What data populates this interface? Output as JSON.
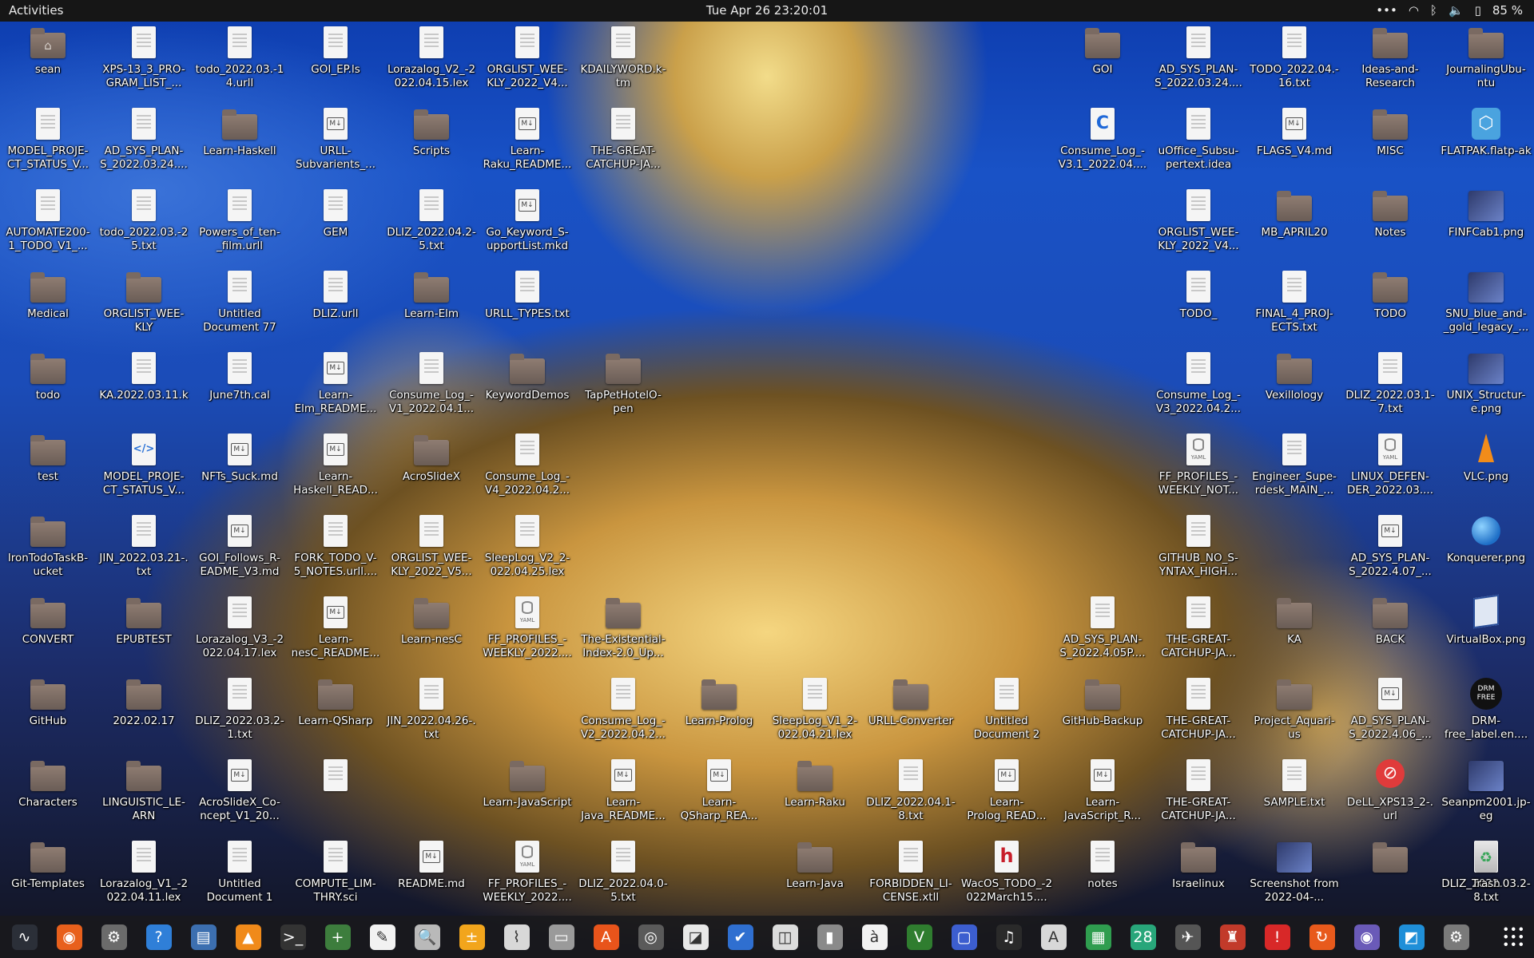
{
  "topbar": {
    "activities": "Activities",
    "clock": "Tue Apr 26  23:20:01",
    "battery": "85 %",
    "tray_icons": [
      "more-dots-icon",
      "wifi-icon",
      "bluetooth-icon",
      "volume-icon",
      "battery-icon"
    ]
  },
  "desktop_icons": [
    {
      "label": "sean",
      "type": "home"
    },
    {
      "label": "XPS-13_3_PRO-GRAM_LIST_...",
      "type": "doc"
    },
    {
      "label": "todo_2022.03.-14.urll",
      "type": "doc"
    },
    {
      "label": "GOI_EP.ls",
      "type": "doc"
    },
    {
      "label": "Lorazalog_V2_-2022.04.15.lex",
      "type": "doc"
    },
    {
      "label": "ORGLIST_WEE-KLY_2022_V4...",
      "type": "doc"
    },
    {
      "label": "KDAILYWORD.k-tm",
      "type": "doc"
    },
    {
      "label": "GOI",
      "type": "folder"
    },
    {
      "label": "AD_SYS_PLAN-S_2022.03.24....",
      "type": "doc"
    },
    {
      "label": "TODO_2022.04.-16.txt",
      "type": "doc"
    },
    {
      "label": "Ideas-and-Research",
      "type": "folder"
    },
    {
      "label": "JournalingUbu-ntu",
      "type": "folder"
    },
    {
      "label": "MODEL_PROJE-CT_STATUS_V...",
      "type": "doc"
    },
    {
      "label": "AD_SYS_PLAN-S_2022.03.24....",
      "type": "doc"
    },
    {
      "label": "Learn-Haskell",
      "type": "folder"
    },
    {
      "label": "URLL-Subvarients_...",
      "type": "md"
    },
    {
      "label": "Scripts",
      "type": "folder"
    },
    {
      "label": "Learn-Raku_README...",
      "type": "md"
    },
    {
      "label": "THE-GREAT-CATCHUP-JA...",
      "type": "doc"
    },
    {
      "label": "Consume_Log_-V3.1_2022.04....",
      "type": "cdoc"
    },
    {
      "label": "uOffice_Subsu-pertext.idea",
      "type": "doc"
    },
    {
      "label": "FLAGS_V4.md",
      "type": "md"
    },
    {
      "label": "MISC",
      "type": "folder"
    },
    {
      "label": "FLATPAK.flatp-ak",
      "type": "flatpak"
    },
    {
      "label": "AUTOMATE200-1_TODO_V1_...",
      "type": "doc"
    },
    {
      "label": "todo_2022.03.-25.txt",
      "type": "doc"
    },
    {
      "label": "Powers_of_ten-_film.urll",
      "type": "doc"
    },
    {
      "label": "GEM",
      "type": "doc"
    },
    {
      "label": "DLIZ_2022.04.2-5.txt",
      "type": "doc"
    },
    {
      "label": "Go_Keyword_S-upportList.mkd",
      "type": "md"
    },
    {
      "label": "ORGLIST_WEE-KLY_2022_V4...",
      "type": "doc"
    },
    {
      "label": "MB_APRIL20",
      "type": "folder"
    },
    {
      "label": "Notes",
      "type": "folder"
    },
    {
      "label": "FINFCab1.png",
      "type": "img"
    },
    {
      "label": "Medical",
      "type": "folder"
    },
    {
      "label": "ORGLIST_WEE-KLY",
      "type": "folder"
    },
    {
      "label": "Untitled Document 77",
      "type": "doc"
    },
    {
      "label": "DLIZ.urll",
      "type": "doc"
    },
    {
      "label": "Learn-Elm",
      "type": "folder"
    },
    {
      "label": "URLL_TYPES.txt",
      "type": "doc"
    },
    {
      "label": "TODO_",
      "type": "doc"
    },
    {
      "label": "FINAL_4_PROJ-ECTS.txt",
      "type": "doc"
    },
    {
      "label": "TODO",
      "type": "folder"
    },
    {
      "label": "SNU_blue_and-_gold_legacy_...",
      "type": "img"
    },
    {
      "label": "todo",
      "type": "folder"
    },
    {
      "label": "KA.2022.03.11.k",
      "type": "doc"
    },
    {
      "label": "June7th.cal",
      "type": "doc"
    },
    {
      "label": "Learn-Elm_README...",
      "type": "md"
    },
    {
      "label": "Consume_Log_-V1_2022.04.1...",
      "type": "doc"
    },
    {
      "label": "KeywordDemos",
      "type": "folder"
    },
    {
      "label": "TapPetHotelO-pen",
      "type": "folder"
    },
    {
      "label": "Consume_Log_-V3_2022.04.2...",
      "type": "doc"
    },
    {
      "label": "Vexillology",
      "type": "folder"
    },
    {
      "label": "DLIZ_2022.03.1-7.txt",
      "type": "doc"
    },
    {
      "label": "UNIX_Structur-e.png",
      "type": "img"
    },
    {
      "label": "test",
      "type": "folder"
    },
    {
      "label": "MODEL_PROJE-CT_STATUS_V...",
      "type": "code"
    },
    {
      "label": "NFTs_Suck.md",
      "type": "md"
    },
    {
      "label": "Learn-Haskell_READ...",
      "type": "md"
    },
    {
      "label": "AcroSlideX",
      "type": "folder"
    },
    {
      "label": "Consume_Log_-V4_2022.04.2...",
      "type": "doc"
    },
    {
      "label": "FF_PROFILES_-WEEKLY_NOT...",
      "type": "yaml"
    },
    {
      "label": "Engineer_Supe-rdesk_MAIN_...",
      "type": "doc"
    },
    {
      "label": "LINUX_DEFEN-DER_2022.03....",
      "type": "yaml"
    },
    {
      "label": "VLC.png",
      "type": "vlc"
    },
    {
      "label": "IronTodoTaskB-ucket",
      "type": "folder"
    },
    {
      "label": "JIN_2022.03.21-.txt",
      "type": "doc"
    },
    {
      "label": "GOI_Follows_R-EADME_V3.md",
      "type": "md"
    },
    {
      "label": "FORK_TODO_V-5_NOTES.urll....",
      "type": "doc"
    },
    {
      "label": "ORGLIST_WEE-KLY_2022_V5...",
      "type": "doc"
    },
    {
      "label": "SleepLog_V2_2-022.04.25.lex",
      "type": "doc"
    },
    {
      "label": "GITHUB_NO_S-YNTAX_HIGH...",
      "type": "doc"
    },
    {
      "label": "AD_SYS_PLAN-S_2022.4.07_...",
      "type": "md"
    },
    {
      "label": "Konquerer.png",
      "type": "globe"
    },
    {
      "label": "CONVERT",
      "type": "folder"
    },
    {
      "label": "EPUBTEST",
      "type": "folder"
    },
    {
      "label": "Lorazalog_V3_-2022.04.17.lex",
      "type": "doc"
    },
    {
      "label": "Learn-nesC_README...",
      "type": "md"
    },
    {
      "label": "Learn-nesC",
      "type": "folder"
    },
    {
      "label": "FF_PROFILES_-WEEKLY_2022....",
      "type": "yaml"
    },
    {
      "label": "The-Existential-Index-2.0_Up...",
      "type": "folder"
    },
    {
      "label": "AD_SYS_PLAN-S_2022.4.05P....",
      "type": "doc"
    },
    {
      "label": "THE-GREAT-CATCHUP-JA...",
      "type": "doc"
    },
    {
      "label": "KA",
      "type": "folder"
    },
    {
      "label": "BACK",
      "type": "folder"
    },
    {
      "label": "VirtualBox.png",
      "type": "vbox"
    },
    {
      "label": "GitHub",
      "type": "folder"
    },
    {
      "label": "2022.02.17",
      "type": "folder"
    },
    {
      "label": "DLIZ_2022.03.2-1.txt",
      "type": "doc"
    },
    {
      "label": "Learn-QSharp",
      "type": "folder"
    },
    {
      "label": "JIN_2022.04.26-.txt",
      "type": "doc"
    },
    {
      "label": "Consume_Log_-V2_2022.04.2...",
      "type": "doc"
    },
    {
      "label": "Learn-Prolog",
      "type": "folder"
    },
    {
      "label": "SleepLog_V1_2-022.04.21.lex",
      "type": "doc"
    },
    {
      "label": "URLL-Converter",
      "type": "folder"
    },
    {
      "label": "Untitled Document 2",
      "type": "doc"
    },
    {
      "label": "GitHub-Backup",
      "type": "folder"
    },
    {
      "label": "THE-GREAT-CATCHUP-JA...",
      "type": "doc"
    },
    {
      "label": "Project_Aquari-us",
      "type": "folder"
    },
    {
      "label": "AD_SYS_PLAN-S_2022.4.06_...",
      "type": "md"
    },
    {
      "label": "DRM-free_label.en....",
      "type": "drm"
    },
    {
      "label": "Characters",
      "type": "folder"
    },
    {
      "label": "LINGUISTIC_LE-ARN",
      "type": "folder"
    },
    {
      "label": "AcroSlideX_Co-ncept_V1_20...",
      "type": "md"
    },
    {
      "label": "",
      "type": "doc"
    },
    {
      "label": "Learn-JavaScript",
      "type": "folder"
    },
    {
      "label": "Learn-Java_README...",
      "type": "md"
    },
    {
      "label": "Learn-QSharp_REA...",
      "type": "md"
    },
    {
      "label": "Learn-Raku",
      "type": "folder"
    },
    {
      "label": "DLIZ_2022.04.1-8.txt",
      "type": "doc"
    },
    {
      "label": "Learn-Prolog_READ...",
      "type": "md"
    },
    {
      "label": "Learn-JavaScript_R...",
      "type": "md"
    },
    {
      "label": "THE-GREAT-CATCHUP-JA...",
      "type": "doc"
    },
    {
      "label": "SAMPLE.txt",
      "type": "doc"
    },
    {
      "label": "DeLL_XPS13_2-.url",
      "type": "dell"
    },
    {
      "label": "Seanpm2001.jp-eg",
      "type": "img"
    },
    {
      "label": "Git-Templates",
      "type": "folder"
    },
    {
      "label": "Lorazalog_V1_-2022.04.11.lex",
      "type": "doc"
    },
    {
      "label": "Untitled Document 1",
      "type": "doc"
    },
    {
      "label": "COMPUTE_LIM-THRY.sci",
      "type": "doc"
    },
    {
      "label": "README.md",
      "type": "md"
    },
    {
      "label": "FF_PROFILES_-WEEKLY_2022....",
      "type": "yaml"
    },
    {
      "label": "DLIZ_2022.04.0-5.txt",
      "type": "doc"
    },
    {
      "label": "Learn-Java",
      "type": "folder"
    },
    {
      "label": "FORBIDDEN_LI-CENSE.xtll",
      "type": "doc"
    },
    {
      "label": "WacOS_TODO_-2022March15....",
      "type": "hdoc"
    },
    {
      "label": "notes",
      "type": "doc"
    },
    {
      "label": "Israelinux",
      "type": "folder"
    },
    {
      "label": "Screenshot from 2022-04-...",
      "type": "img"
    },
    {
      "label": "",
      "type": "folder"
    },
    {
      "label": "DLIZ_2022.03.2-8.txt",
      "type": "doc"
    },
    {
      "label": "Trash",
      "type": "trash"
    }
  ],
  "dock": {
    "items": [
      {
        "name": "system-monitor-icon",
        "glyph": "∿",
        "color": "#2b2f38"
      },
      {
        "name": "firefox-icon",
        "glyph": "◉",
        "color": "#e8601c"
      },
      {
        "name": "settings-icon",
        "glyph": "⚙",
        "color": "#6b6b6b"
      },
      {
        "name": "help-icon",
        "glyph": "?",
        "color": "#2f7fd8"
      },
      {
        "name": "document-viewer-icon",
        "glyph": "▤",
        "color": "#3c6fb0"
      },
      {
        "name": "vlc-icon",
        "glyph": "▲",
        "color": "#f08a1a"
      },
      {
        "name": "terminal-icon",
        "glyph": ">_",
        "color": "#333333"
      },
      {
        "name": "add-icon",
        "glyph": "+",
        "color": "#3d7d3d"
      },
      {
        "name": "text-editor-icon",
        "glyph": "✎",
        "color": "#f2f2f2"
      },
      {
        "name": "search-icon",
        "glyph": "🔍",
        "color": "#b9b9b9"
      },
      {
        "name": "calculator-icon",
        "glyph": "±",
        "color": "#f2a51c"
      },
      {
        "name": "chart-icon",
        "glyph": "⌇",
        "color": "#d8d8d8"
      },
      {
        "name": "files-icon",
        "glyph": "▭",
        "color": "#9a9a9a"
      },
      {
        "name": "app-store-icon",
        "glyph": "A",
        "color": "#e8541b"
      },
      {
        "name": "disc-icon",
        "glyph": "◎",
        "color": "#5a5a5a"
      },
      {
        "name": "office-icon",
        "glyph": "◪",
        "color": "#e8e8e8"
      },
      {
        "name": "tasks-icon",
        "glyph": "✔",
        "color": "#2f6fd0"
      },
      {
        "name": "reader-icon",
        "glyph": "◫",
        "color": "#dcdcdc"
      },
      {
        "name": "archive-icon",
        "glyph": "▮",
        "color": "#8a8a8a"
      },
      {
        "name": "character-map-icon",
        "glyph": "à",
        "color": "#f2f2f2"
      },
      {
        "name": "vim-icon",
        "glyph": "V",
        "color": "#2f7d2f"
      },
      {
        "name": "screen-icon",
        "glyph": "▢",
        "color": "#3c5ecf"
      },
      {
        "name": "music-icon",
        "glyph": "♫",
        "color": "#2a2a2a"
      },
      {
        "name": "pdf-icon",
        "glyph": "A",
        "color": "#d8d8d8"
      },
      {
        "name": "spreadsheet-icon",
        "glyph": "▦",
        "color": "#2f9d4f"
      },
      {
        "name": "calendar-icon",
        "glyph": "28",
        "color": "#28a67a"
      },
      {
        "name": "tool-icon",
        "glyph": "✈",
        "color": "#555555"
      },
      {
        "name": "game-icon",
        "glyph": "♜",
        "color": "#c23a2a"
      },
      {
        "name": "alert-icon",
        "glyph": "!",
        "color": "#d82828"
      },
      {
        "name": "update-icon",
        "glyph": "↻",
        "color": "#e85a1c"
      },
      {
        "name": "screenshot-icon",
        "glyph": "◉",
        "color": "#6a5ab8"
      },
      {
        "name": "weather-icon",
        "glyph": "◩",
        "color": "#1f8fd8"
      },
      {
        "name": "software-icon",
        "glyph": "⚙",
        "color": "#7a7a7a"
      }
    ]
  }
}
